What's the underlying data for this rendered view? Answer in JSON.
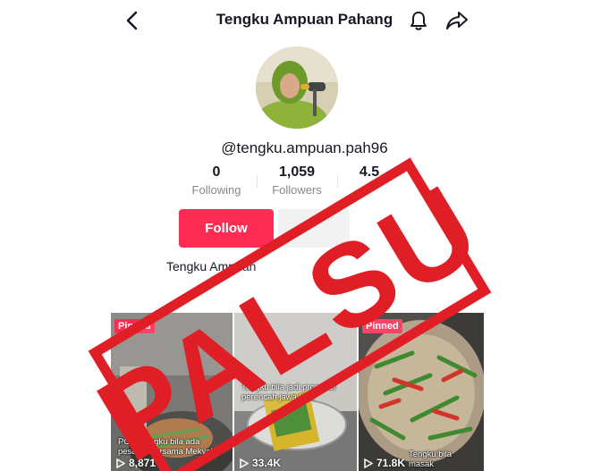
{
  "header": {
    "title": "Tengku Ampuan Pahang",
    "icons": [
      "back-icon",
      "bell-icon",
      "share-icon"
    ]
  },
  "profile": {
    "username": "@tengku.ampuan.pah96",
    "bio": "Tengku Ampuan"
  },
  "stats": [
    {
      "value": "0",
      "label": "Following"
    },
    {
      "value": "1,059",
      "label": "Followers"
    },
    {
      "value": "4.5",
      "label": ""
    }
  ],
  "actions": {
    "follow_label": "Follow"
  },
  "videos": [
    {
      "badge": "Pinned",
      "caption": "POV: Tengku bila ada pesaing bersama Mekyah",
      "views": "8,871"
    },
    {
      "badge": "",
      "caption": "Tengku bila jadi promoter perencah jawa kitar",
      "views": "33.4K"
    },
    {
      "badge": "Pinned",
      "caption": "Tengku bila masak",
      "views": "71.8K"
    }
  ],
  "stamp": {
    "text": "PALSU",
    "color": "#e01e26"
  },
  "colors": {
    "accent": "#fe2c55",
    "text": "#161823",
    "muted": "#86878b"
  }
}
